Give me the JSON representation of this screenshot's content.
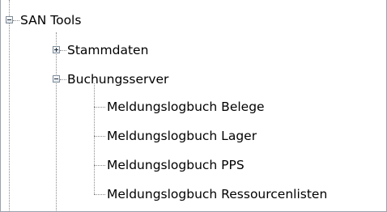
{
  "tree": {
    "root": {
      "label": "SAN Tools",
      "state": "expanded"
    },
    "nodes": [
      {
        "label": "Stammdaten",
        "state": "collapsed"
      },
      {
        "label": "Buchungsserver",
        "state": "expanded"
      }
    ],
    "leaves": [
      {
        "label": "Meldungslogbuch Belege"
      },
      {
        "label": "Meldungslogbuch Lager"
      },
      {
        "label": "Meldungslogbuch PPS"
      },
      {
        "label": "Meldungslogbuch Ressourcenlisten"
      }
    ]
  },
  "colors": {
    "connector": "#8c8c8c",
    "expander_border": "#7f8d99",
    "text": "#000000"
  }
}
